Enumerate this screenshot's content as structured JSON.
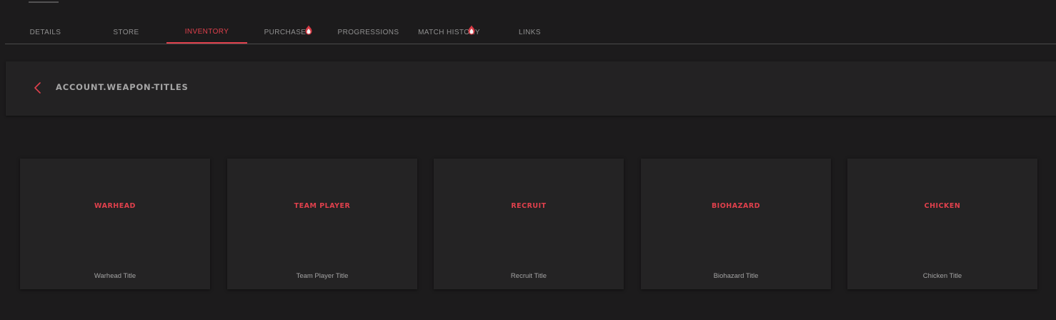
{
  "tabs": [
    {
      "label": "DETAILS",
      "active": false,
      "badge": false
    },
    {
      "label": "STORE",
      "active": false,
      "badge": false
    },
    {
      "label": "INVENTORY",
      "active": true,
      "badge": false
    },
    {
      "label": "PURCHASES",
      "active": false,
      "badge": true
    },
    {
      "label": "PROGRESSIONS",
      "active": false,
      "badge": false
    },
    {
      "label": "MATCH HISTORY",
      "active": false,
      "badge": true
    },
    {
      "label": "LINKS",
      "active": false,
      "badge": false
    }
  ],
  "header": {
    "title": "ACCOUNT.WEAPON-TITLES",
    "back_icon": "chevron-left-icon"
  },
  "cards": [
    {
      "name": "WARHEAD",
      "title": "Warhead Title"
    },
    {
      "name": "TEAM PLAYER",
      "title": "Team Player Title"
    },
    {
      "name": "RECRUIT",
      "title": "Recruit Title"
    },
    {
      "name": "BIOHAZARD",
      "title": "Biohazard Title"
    },
    {
      "name": "CHICKEN",
      "title": "Chicken Title"
    }
  ],
  "colors": {
    "accent": "#e0404c",
    "background": "#1c1b1c",
    "panel": "#232223",
    "muted_text": "#8f8f8f"
  }
}
